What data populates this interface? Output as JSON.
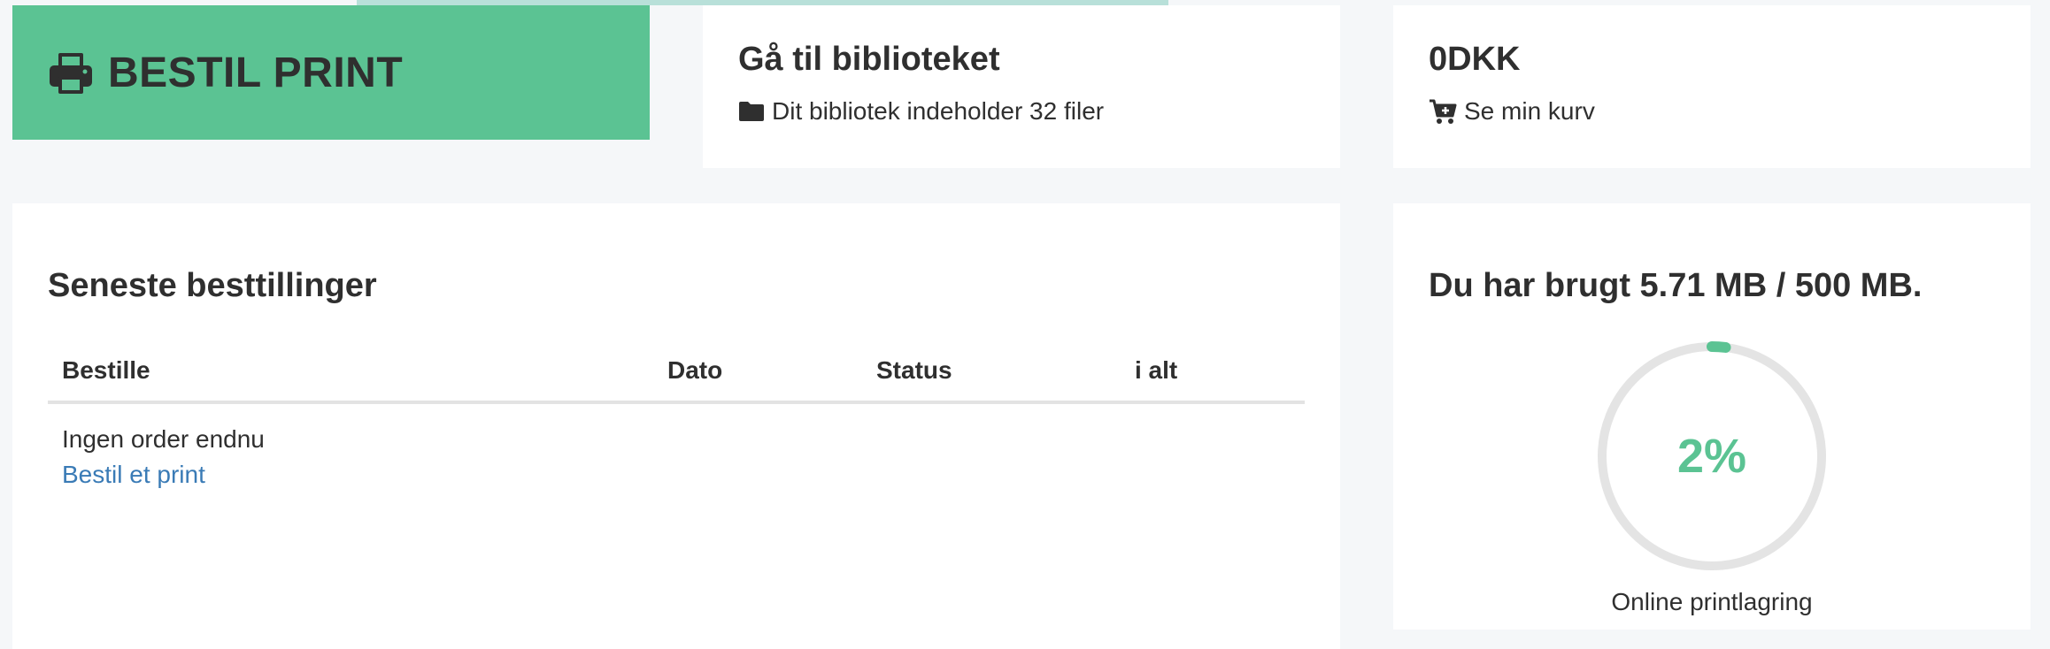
{
  "order_tile": {
    "label": "BESTIL PRINT",
    "icon": "printer-icon",
    "color": "#5bc393"
  },
  "library": {
    "title": "Gå til biblioteket",
    "subtitle": "Dit bibliotek indeholder 32 filer",
    "icon": "folder-icon"
  },
  "cart": {
    "total": "0DKK",
    "link_label": "Se min kurv",
    "icon": "cart-icon"
  },
  "orders": {
    "title": "Seneste besttillinger",
    "columns": [
      "Bestille",
      "Dato",
      "Status",
      "i alt"
    ],
    "empty_text": "Ingen order endnu",
    "empty_link": "Bestil et print"
  },
  "storage": {
    "title": "Du har brugt 5.71 MB / 500 MB.",
    "percent_label": "2%",
    "percent": 0.02,
    "caption": "Online printlagring",
    "accent_color": "#5bc393",
    "track_color": "#e4e4e4"
  }
}
